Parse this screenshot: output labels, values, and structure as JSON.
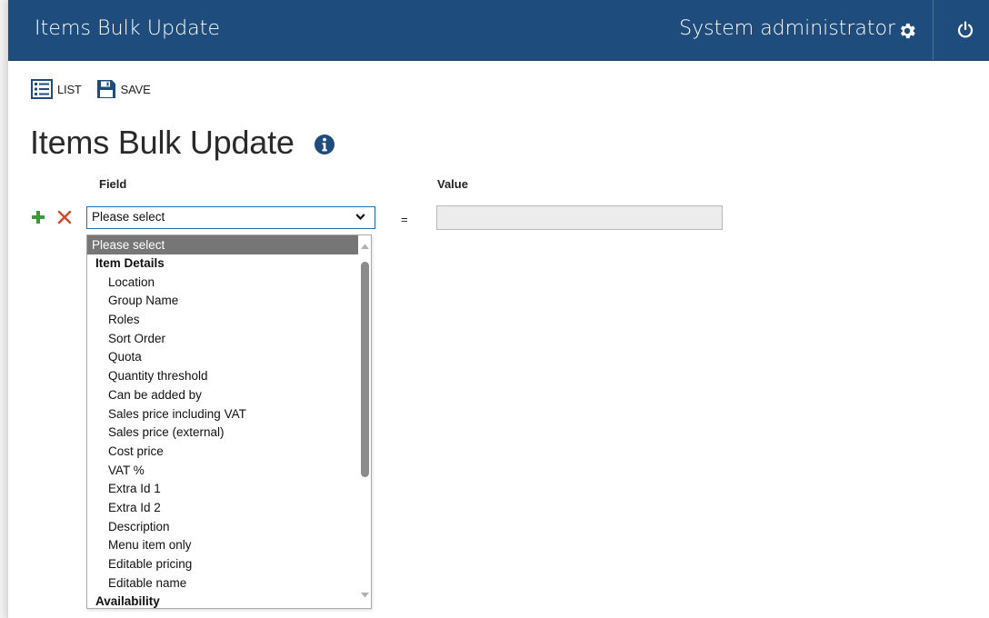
{
  "header": {
    "app_title": "Items Bulk Update",
    "user_name": "System administrator",
    "icons": [
      "gear-icon",
      "power-icon"
    ]
  },
  "toolbar": {
    "list_label": "LIST",
    "save_label": "SAVE"
  },
  "page": {
    "title": "Items Bulk Update"
  },
  "form": {
    "field_label": "Field",
    "value_label": "Value",
    "equals": "=",
    "selected_field": "Please select",
    "value": ""
  },
  "dropdown": {
    "options": [
      {
        "label": "Please select",
        "kind": "selected"
      },
      {
        "label": "Item Details",
        "kind": "group"
      },
      {
        "label": "Location",
        "kind": "option"
      },
      {
        "label": "Group Name",
        "kind": "option"
      },
      {
        "label": "Roles",
        "kind": "option"
      },
      {
        "label": "Sort Order",
        "kind": "option"
      },
      {
        "label": "Quota",
        "kind": "option"
      },
      {
        "label": "Quantity threshold",
        "kind": "option"
      },
      {
        "label": "Can be added by",
        "kind": "option"
      },
      {
        "label": "Sales price including VAT",
        "kind": "option"
      },
      {
        "label": "Sales price (external)",
        "kind": "option"
      },
      {
        "label": "Cost price",
        "kind": "option"
      },
      {
        "label": "VAT %",
        "kind": "option"
      },
      {
        "label": "Extra Id 1",
        "kind": "option"
      },
      {
        "label": "Extra Id 2",
        "kind": "option"
      },
      {
        "label": "Description",
        "kind": "option"
      },
      {
        "label": "Menu item only",
        "kind": "option"
      },
      {
        "label": "Editable pricing",
        "kind": "option"
      },
      {
        "label": "Editable name",
        "kind": "option"
      },
      {
        "label": "Availability",
        "kind": "group"
      }
    ]
  },
  "colors": {
    "header_bg": "#1d4c7d",
    "accent": "#1e6fb3",
    "add_green": "#3a9a3a",
    "remove_red": "#d9452b",
    "selected_option_bg": "#767676"
  }
}
